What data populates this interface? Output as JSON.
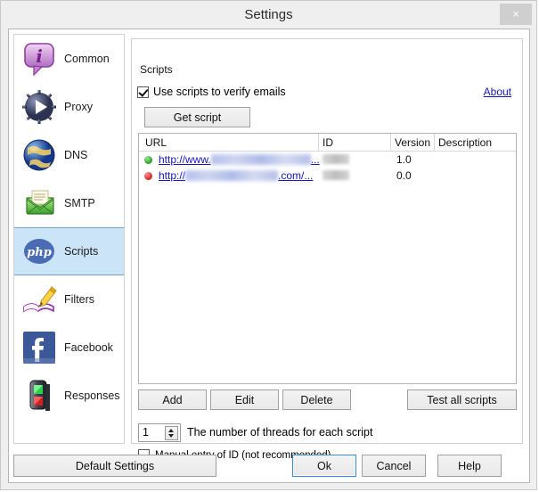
{
  "window": {
    "title": "Settings",
    "close_label": "×",
    "close_icon": "close-icon"
  },
  "sidebar": {
    "items": [
      {
        "label": "Common",
        "icon": "info-bubble-icon",
        "selected": false
      },
      {
        "label": "Proxy",
        "icon": "proxy-badge-icon",
        "selected": false
      },
      {
        "label": "DNS",
        "icon": "globe-icon",
        "selected": false
      },
      {
        "label": "SMTP",
        "icon": "envelope-icon",
        "selected": false
      },
      {
        "label": "Scripts",
        "icon": "php-icon",
        "selected": true
      },
      {
        "label": "Filters",
        "icon": "book-pencil-icon",
        "selected": false
      },
      {
        "label": "Facebook",
        "icon": "facebook-icon",
        "selected": false
      },
      {
        "label": "Responses",
        "icon": "traffic-light-icon",
        "selected": false
      }
    ]
  },
  "scripts_group": {
    "title": "Scripts",
    "use_scripts_checkbox": {
      "label": "Use scripts to verify emails",
      "checked": true
    },
    "about_link": "About",
    "get_script_button": "Get script",
    "table": {
      "columns": [
        "URL",
        "ID",
        "Version",
        "Description"
      ],
      "rows": [
        {
          "status": "green",
          "url_prefix": "http://www.",
          "url_suffix": "...",
          "url_redacted_width": 112,
          "id": "",
          "id_redacted": true,
          "version": "1.0",
          "description": ""
        },
        {
          "status": "red",
          "url_prefix": "http://",
          "url_mid": ".com/",
          "url_suffix": "...",
          "url_redacted_width": 104,
          "id": "",
          "id_redacted": true,
          "version": "0.0",
          "description": ""
        }
      ]
    },
    "buttons": {
      "add": "Add",
      "edit": "Edit",
      "delete": "Delete",
      "test_all": "Test all scripts"
    },
    "threads": {
      "value": "1",
      "label": "The number of threads for each script"
    },
    "manual_entry_checkbox": {
      "label": "Manual entry of ID (not recommended)",
      "checked": false
    }
  },
  "footer": {
    "default_settings": "Default Settings",
    "ok": "Ok",
    "cancel": "Cancel",
    "help": "Help"
  },
  "colors": {
    "selection_bg": "#cce4f7",
    "selection_border": "#6ba4d8",
    "link": "#1414cf",
    "status_ok": "#2faa2c",
    "status_error": "#e02b2b",
    "focus_border": "#2f8fe0"
  }
}
